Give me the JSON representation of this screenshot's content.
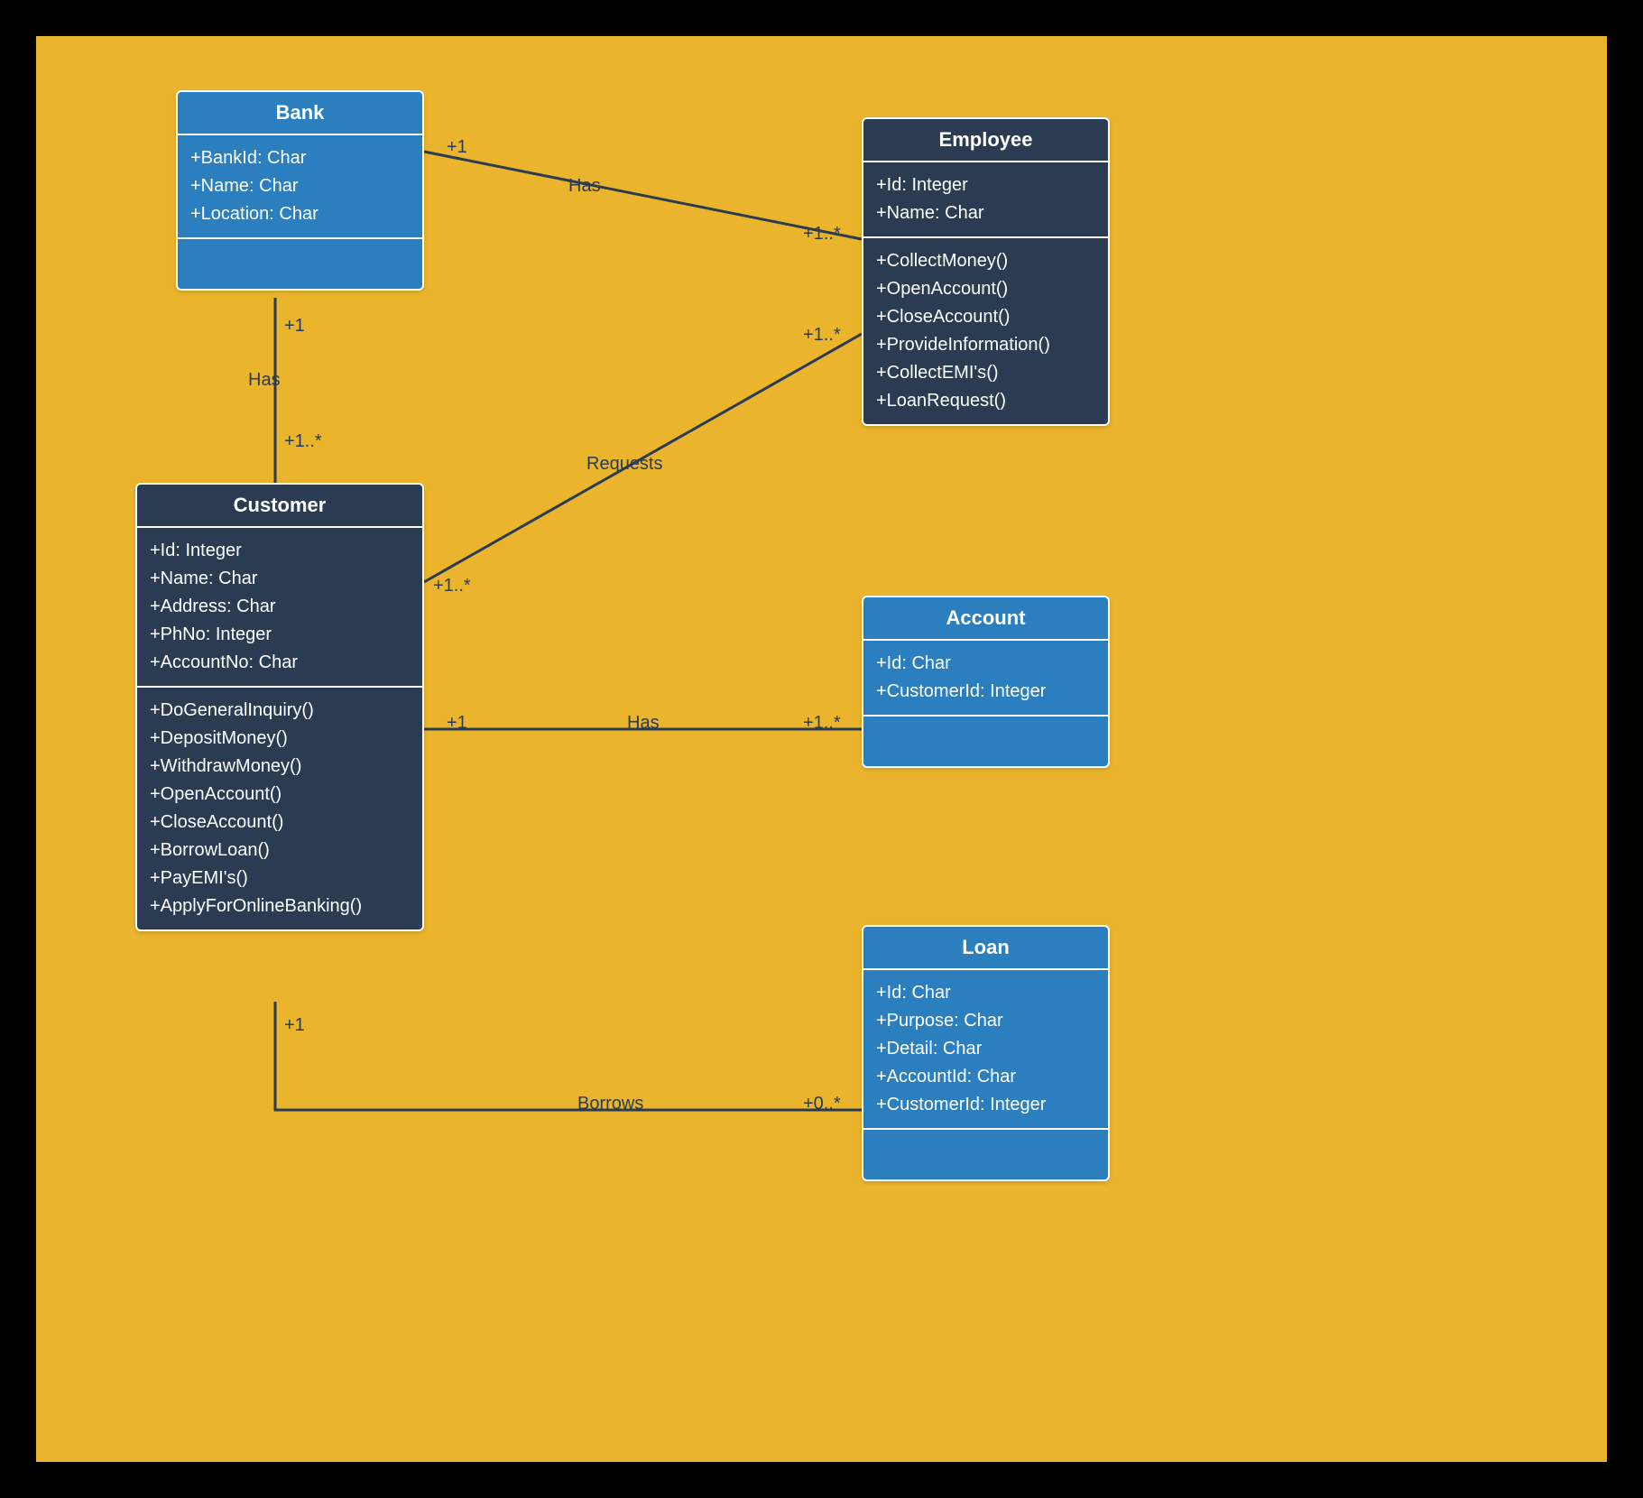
{
  "classes": {
    "bank": {
      "name": "Bank",
      "attributes": [
        "+BankId: Char",
        "+Name: Char",
        "+Location: Char"
      ],
      "methods": []
    },
    "employee": {
      "name": "Employee",
      "attributes": [
        "+Id: Integer",
        "+Name: Char"
      ],
      "methods": [
        "+CollectMoney()",
        "+OpenAccount()",
        "+CloseAccount()",
        "+ProvideInformation()",
        "+CollectEMI's()",
        "+LoanRequest()"
      ]
    },
    "customer": {
      "name": "Customer",
      "attributes": [
        "+Id: Integer",
        "+Name: Char",
        "+Address: Char",
        "+PhNo: Integer",
        "+AccountNo: Char"
      ],
      "methods": [
        "+DoGeneralInquiry()",
        "+DepositMoney()",
        "+WithdrawMoney()",
        "+OpenAccount()",
        "+CloseAccount()",
        "+BorrowLoan()",
        "+PayEMI's()",
        "+ApplyForOnlineBanking()"
      ]
    },
    "account": {
      "name": "Account",
      "attributes": [
        "+Id: Char",
        "+CustomerId: Integer"
      ],
      "methods": []
    },
    "loan": {
      "name": "Loan",
      "attributes": [
        "+Id: Char",
        "+Purpose: Char",
        "+Detail: Char",
        "+AccountId: Char",
        "+CustomerId: Integer"
      ],
      "methods": []
    }
  },
  "associations": {
    "bank_employee": {
      "label": "Has",
      "m1": "+1",
      "m2": "+1..*"
    },
    "bank_customer": {
      "label": "Has",
      "m1": "+1",
      "m2": "+1..*"
    },
    "customer_employee": {
      "label": "Requests",
      "m1": "+1..*",
      "m2": "+1..*"
    },
    "customer_account": {
      "label": "Has",
      "m1": "+1",
      "m2": "+1..*"
    },
    "customer_loan": {
      "label": "Borrows",
      "m1": "+1",
      "m2": "+0..*"
    }
  }
}
